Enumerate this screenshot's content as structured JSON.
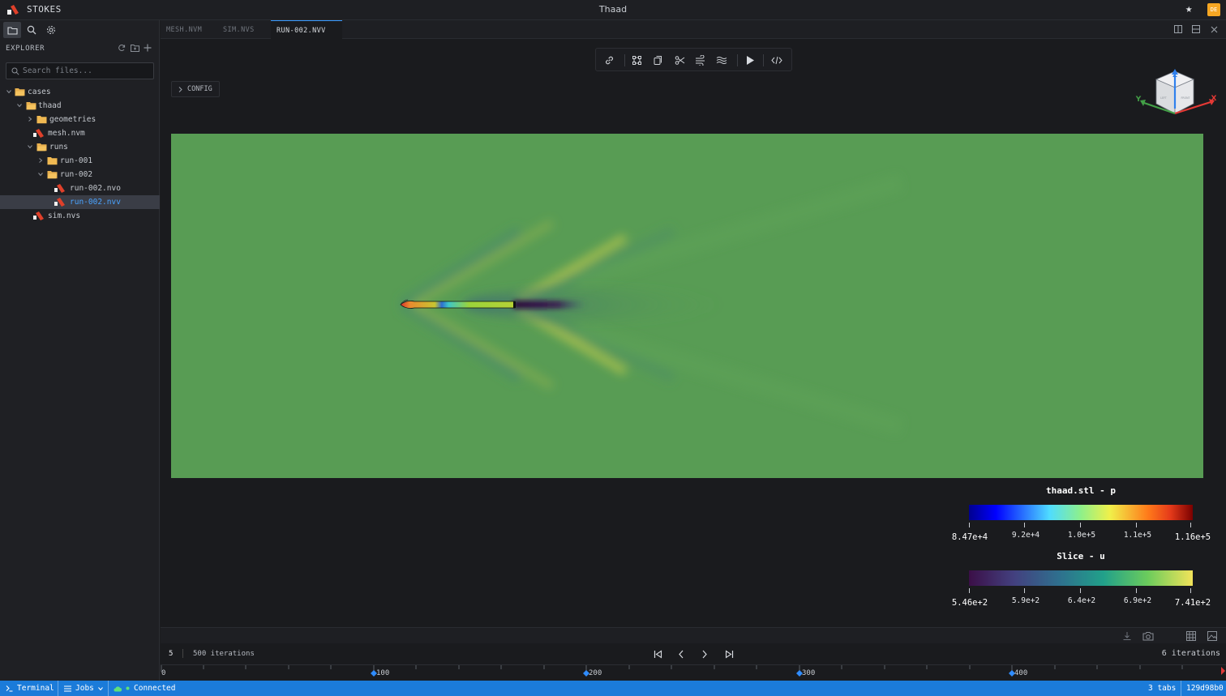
{
  "app": {
    "name": "STOKES",
    "window_title": "Thaad",
    "user_initials": "DE"
  },
  "sidebar": {
    "explorer_title": "EXPLORER",
    "search_placeholder": "Search files...",
    "tree": [
      {
        "label": "cases",
        "type": "folder",
        "open": true,
        "depth": 0
      },
      {
        "label": "thaad",
        "type": "folder",
        "open": true,
        "depth": 1
      },
      {
        "label": "geometries",
        "type": "folder",
        "open": false,
        "depth": 2
      },
      {
        "label": "mesh.nvm",
        "type": "file",
        "depth": 2
      },
      {
        "label": "runs",
        "type": "folder",
        "open": true,
        "depth": 2
      },
      {
        "label": "run-001",
        "type": "folder",
        "open": false,
        "depth": 3
      },
      {
        "label": "run-002",
        "type": "folder",
        "open": true,
        "depth": 3
      },
      {
        "label": "run-002.nvo",
        "type": "file",
        "depth": 4
      },
      {
        "label": "run-002.nvv",
        "type": "file",
        "depth": 4,
        "selected": true
      },
      {
        "label": "sim.nvs",
        "type": "file",
        "depth": 2
      }
    ]
  },
  "tabs": [
    {
      "label": "MESH.NVM",
      "active": false
    },
    {
      "label": "SIM.NVS",
      "active": false
    },
    {
      "label": "RUN-002.NVV",
      "active": true
    }
  ],
  "viewport": {
    "config_label": "CONFIG",
    "axes": {
      "x": "X",
      "y": "Y",
      "z": "Z",
      "cube_left": "LEFT",
      "cube_front": "FRONT"
    }
  },
  "legends": [
    {
      "title": "thaad.stl - p",
      "colormap": "jet",
      "labels": [
        "8.47e+4",
        "9.2e+4",
        "1.0e+5",
        "1.1e+5",
        "1.16e+5"
      ]
    },
    {
      "title": "Slice - u",
      "colormap": "viridis",
      "labels": [
        "5.46e+2",
        "5.9e+2",
        "6.4e+2",
        "6.9e+2",
        "7.41e+2"
      ]
    }
  ],
  "playback": {
    "current": "5",
    "total_label": "500 iterations",
    "right_label": "6 iterations"
  },
  "timeline": {
    "labels": [
      "0",
      "100",
      "200",
      "300",
      "400"
    ]
  },
  "statusbar": {
    "terminal": "Terminal",
    "jobs": "Jobs",
    "connection": "Connected",
    "tabs_count": "3 tabs",
    "commit": "129d98b0"
  },
  "colors": {
    "accent": "#1b7bd9",
    "tab_active_border": "#3a9bff",
    "background_field": "#589c54",
    "folder": "#e8b04e",
    "brand_red": "#e0402a"
  }
}
